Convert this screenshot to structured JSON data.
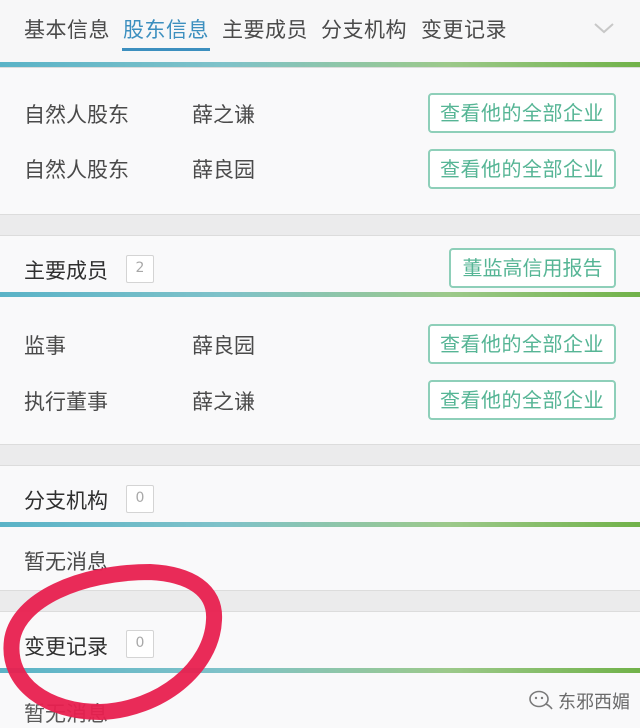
{
  "tabs": [
    {
      "label": "基本信息",
      "active": false
    },
    {
      "label": "股东信息",
      "active": true
    },
    {
      "label": "主要成员",
      "active": false
    },
    {
      "label": "分支机构",
      "active": false
    },
    {
      "label": "变更记录",
      "active": false
    }
  ],
  "shareholders": {
    "rows": [
      {
        "type": "自然人股东",
        "name": "薛之谦",
        "button": "查看他的全部企业"
      },
      {
        "type": "自然人股东",
        "name": "薛良园",
        "button": "查看他的全部企业"
      }
    ]
  },
  "members": {
    "title": "主要成员",
    "count": "2",
    "report_button": "董监高信用报告",
    "rows": [
      {
        "role": "监事",
        "name": "薛良园",
        "button": "查看他的全部企业"
      },
      {
        "role": "执行董事",
        "name": "薛之谦",
        "button": "查看他的全部企业"
      }
    ]
  },
  "branches": {
    "title": "分支机构",
    "count": "0",
    "empty_text": "暂无消息"
  },
  "changes": {
    "title": "变更记录",
    "count": "0",
    "empty_text": "暂无消息"
  },
  "watermark": {
    "text": "东邪西媚",
    "icon": "wechat-official-account-icon"
  },
  "colors": {
    "accent_blue": "#3c8fbf",
    "accent_green": "#56b595",
    "highlight_circle": "#e8204f"
  }
}
